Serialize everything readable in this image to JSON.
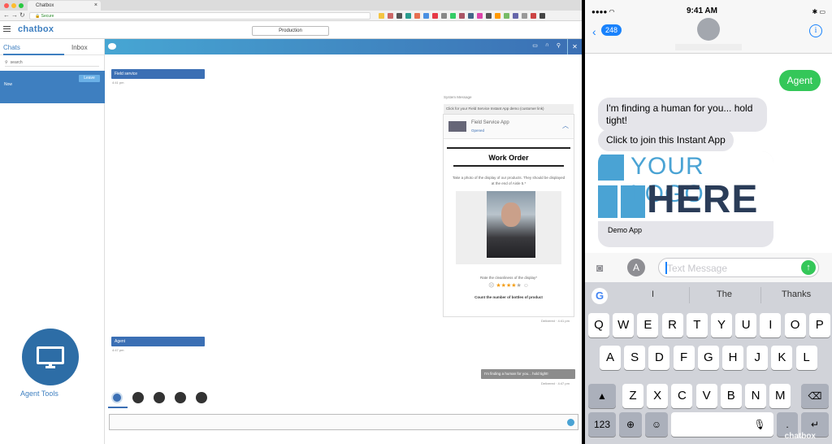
{
  "browser": {
    "tab_title": "Chatbox",
    "address": "Secure",
    "app_logo": "chatbox",
    "environment": "Production"
  },
  "sidebar": {
    "tabs": [
      "Chats",
      "Inbox"
    ],
    "search_placeholder": "search",
    "active_chat": {
      "time": "Now",
      "leave_label": "Leave"
    },
    "agent_tools_label": "Agent Tools"
  },
  "chat": {
    "messages": [
      {
        "label": "Field service",
        "time": "4:41 pm"
      },
      {
        "label": "Agent",
        "time": "4:47 pm"
      }
    ],
    "system_message_title": "System Message",
    "system_message_text": "Click for your Field Service Instant App demo (customer link)",
    "card": {
      "title": "Field Service App",
      "status": "Opened",
      "form_title": "Work Order",
      "instruction": "Take a photo of the display of our products. They should be displayed at the end of Aisle 5.*",
      "rating_label": "Rate the cleanliness of the display*",
      "rating": 4,
      "rating_max": 5,
      "count_label": "Count the number of bottles of product"
    },
    "delivered_1": "Delivered  ·  4:41 pm",
    "agent_reply": "I'm finding a human for you... hold tight!",
    "delivered_2": "Delivered  ·  4:47 pm"
  },
  "phone": {
    "time": "9:41 AM",
    "back_count": "248",
    "sent_message": "Agent",
    "received": [
      "I'm finding a human for you... hold tight!",
      "Click to join this Instant App"
    ],
    "logo_line1": "YOUR LOGO",
    "logo_line2": "HERE",
    "app_name": "Demo App",
    "text_placeholder": "Text Message",
    "suggestions": [
      "I",
      "The",
      "Thanks"
    ],
    "rows": [
      [
        "Q",
        "W",
        "E",
        "R",
        "T",
        "Y",
        "U",
        "I",
        "O",
        "P"
      ],
      [
        "A",
        "S",
        "D",
        "F",
        "G",
        "H",
        "J",
        "K",
        "L"
      ],
      [
        "Z",
        "X",
        "C",
        "V",
        "B",
        "N",
        "M"
      ]
    ],
    "key_123": "123",
    "watermark": "chatbox"
  },
  "colors": {
    "brand_blue": "#3e7fc0",
    "imessage_green": "#34c759",
    "ios_blue": "#1982fc"
  }
}
